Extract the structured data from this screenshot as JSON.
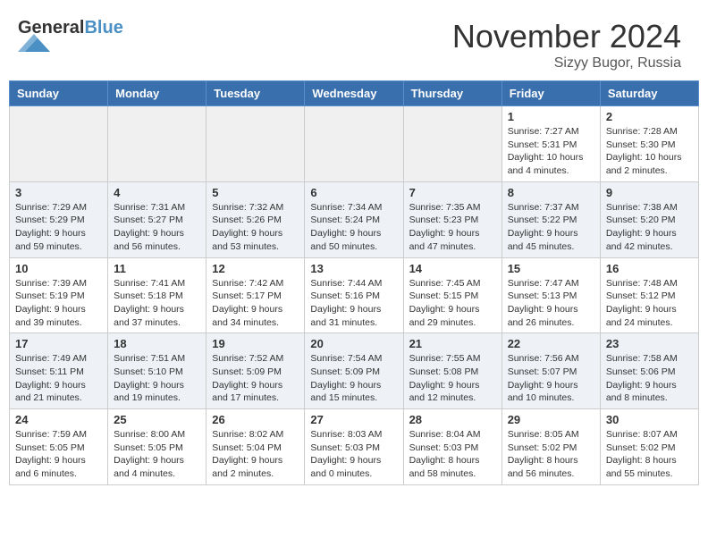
{
  "header": {
    "logo_general": "General",
    "logo_blue": "Blue",
    "month_title": "November 2024",
    "location": "Sizyy Bugor, Russia"
  },
  "weekdays": [
    "Sunday",
    "Monday",
    "Tuesday",
    "Wednesday",
    "Thursday",
    "Friday",
    "Saturday"
  ],
  "weeks": [
    [
      {
        "day": "",
        "info": "",
        "empty": true
      },
      {
        "day": "",
        "info": "",
        "empty": true
      },
      {
        "day": "",
        "info": "",
        "empty": true
      },
      {
        "day": "",
        "info": "",
        "empty": true
      },
      {
        "day": "",
        "info": "",
        "empty": true
      },
      {
        "day": "1",
        "info": "Sunrise: 7:27 AM\nSunset: 5:31 PM\nDaylight: 10 hours\nand 4 minutes.",
        "empty": false
      },
      {
        "day": "2",
        "info": "Sunrise: 7:28 AM\nSunset: 5:30 PM\nDaylight: 10 hours\nand 2 minutes.",
        "empty": false
      }
    ],
    [
      {
        "day": "3",
        "info": "Sunrise: 7:29 AM\nSunset: 5:29 PM\nDaylight: 9 hours\nand 59 minutes.",
        "empty": false
      },
      {
        "day": "4",
        "info": "Sunrise: 7:31 AM\nSunset: 5:27 PM\nDaylight: 9 hours\nand 56 minutes.",
        "empty": false
      },
      {
        "day": "5",
        "info": "Sunrise: 7:32 AM\nSunset: 5:26 PM\nDaylight: 9 hours\nand 53 minutes.",
        "empty": false
      },
      {
        "day": "6",
        "info": "Sunrise: 7:34 AM\nSunset: 5:24 PM\nDaylight: 9 hours\nand 50 minutes.",
        "empty": false
      },
      {
        "day": "7",
        "info": "Sunrise: 7:35 AM\nSunset: 5:23 PM\nDaylight: 9 hours\nand 47 minutes.",
        "empty": false
      },
      {
        "day": "8",
        "info": "Sunrise: 7:37 AM\nSunset: 5:22 PM\nDaylight: 9 hours\nand 45 minutes.",
        "empty": false
      },
      {
        "day": "9",
        "info": "Sunrise: 7:38 AM\nSunset: 5:20 PM\nDaylight: 9 hours\nand 42 minutes.",
        "empty": false
      }
    ],
    [
      {
        "day": "10",
        "info": "Sunrise: 7:39 AM\nSunset: 5:19 PM\nDaylight: 9 hours\nand 39 minutes.",
        "empty": false
      },
      {
        "day": "11",
        "info": "Sunrise: 7:41 AM\nSunset: 5:18 PM\nDaylight: 9 hours\nand 37 minutes.",
        "empty": false
      },
      {
        "day": "12",
        "info": "Sunrise: 7:42 AM\nSunset: 5:17 PM\nDaylight: 9 hours\nand 34 minutes.",
        "empty": false
      },
      {
        "day": "13",
        "info": "Sunrise: 7:44 AM\nSunset: 5:16 PM\nDaylight: 9 hours\nand 31 minutes.",
        "empty": false
      },
      {
        "day": "14",
        "info": "Sunrise: 7:45 AM\nSunset: 5:15 PM\nDaylight: 9 hours\nand 29 minutes.",
        "empty": false
      },
      {
        "day": "15",
        "info": "Sunrise: 7:47 AM\nSunset: 5:13 PM\nDaylight: 9 hours\nand 26 minutes.",
        "empty": false
      },
      {
        "day": "16",
        "info": "Sunrise: 7:48 AM\nSunset: 5:12 PM\nDaylight: 9 hours\nand 24 minutes.",
        "empty": false
      }
    ],
    [
      {
        "day": "17",
        "info": "Sunrise: 7:49 AM\nSunset: 5:11 PM\nDaylight: 9 hours\nand 21 minutes.",
        "empty": false
      },
      {
        "day": "18",
        "info": "Sunrise: 7:51 AM\nSunset: 5:10 PM\nDaylight: 9 hours\nand 19 minutes.",
        "empty": false
      },
      {
        "day": "19",
        "info": "Sunrise: 7:52 AM\nSunset: 5:09 PM\nDaylight: 9 hours\nand 17 minutes.",
        "empty": false
      },
      {
        "day": "20",
        "info": "Sunrise: 7:54 AM\nSunset: 5:09 PM\nDaylight: 9 hours\nand 15 minutes.",
        "empty": false
      },
      {
        "day": "21",
        "info": "Sunrise: 7:55 AM\nSunset: 5:08 PM\nDaylight: 9 hours\nand 12 minutes.",
        "empty": false
      },
      {
        "day": "22",
        "info": "Sunrise: 7:56 AM\nSunset: 5:07 PM\nDaylight: 9 hours\nand 10 minutes.",
        "empty": false
      },
      {
        "day": "23",
        "info": "Sunrise: 7:58 AM\nSunset: 5:06 PM\nDaylight: 9 hours\nand 8 minutes.",
        "empty": false
      }
    ],
    [
      {
        "day": "24",
        "info": "Sunrise: 7:59 AM\nSunset: 5:05 PM\nDaylight: 9 hours\nand 6 minutes.",
        "empty": false
      },
      {
        "day": "25",
        "info": "Sunrise: 8:00 AM\nSunset: 5:05 PM\nDaylight: 9 hours\nand 4 minutes.",
        "empty": false
      },
      {
        "day": "26",
        "info": "Sunrise: 8:02 AM\nSunset: 5:04 PM\nDaylight: 9 hours\nand 2 minutes.",
        "empty": false
      },
      {
        "day": "27",
        "info": "Sunrise: 8:03 AM\nSunset: 5:03 PM\nDaylight: 9 hours\nand 0 minutes.",
        "empty": false
      },
      {
        "day": "28",
        "info": "Sunrise: 8:04 AM\nSunset: 5:03 PM\nDaylight: 8 hours\nand 58 minutes.",
        "empty": false
      },
      {
        "day": "29",
        "info": "Sunrise: 8:05 AM\nSunset: 5:02 PM\nDaylight: 8 hours\nand 56 minutes.",
        "empty": false
      },
      {
        "day": "30",
        "info": "Sunrise: 8:07 AM\nSunset: 5:02 PM\nDaylight: 8 hours\nand 55 minutes.",
        "empty": false
      }
    ]
  ]
}
